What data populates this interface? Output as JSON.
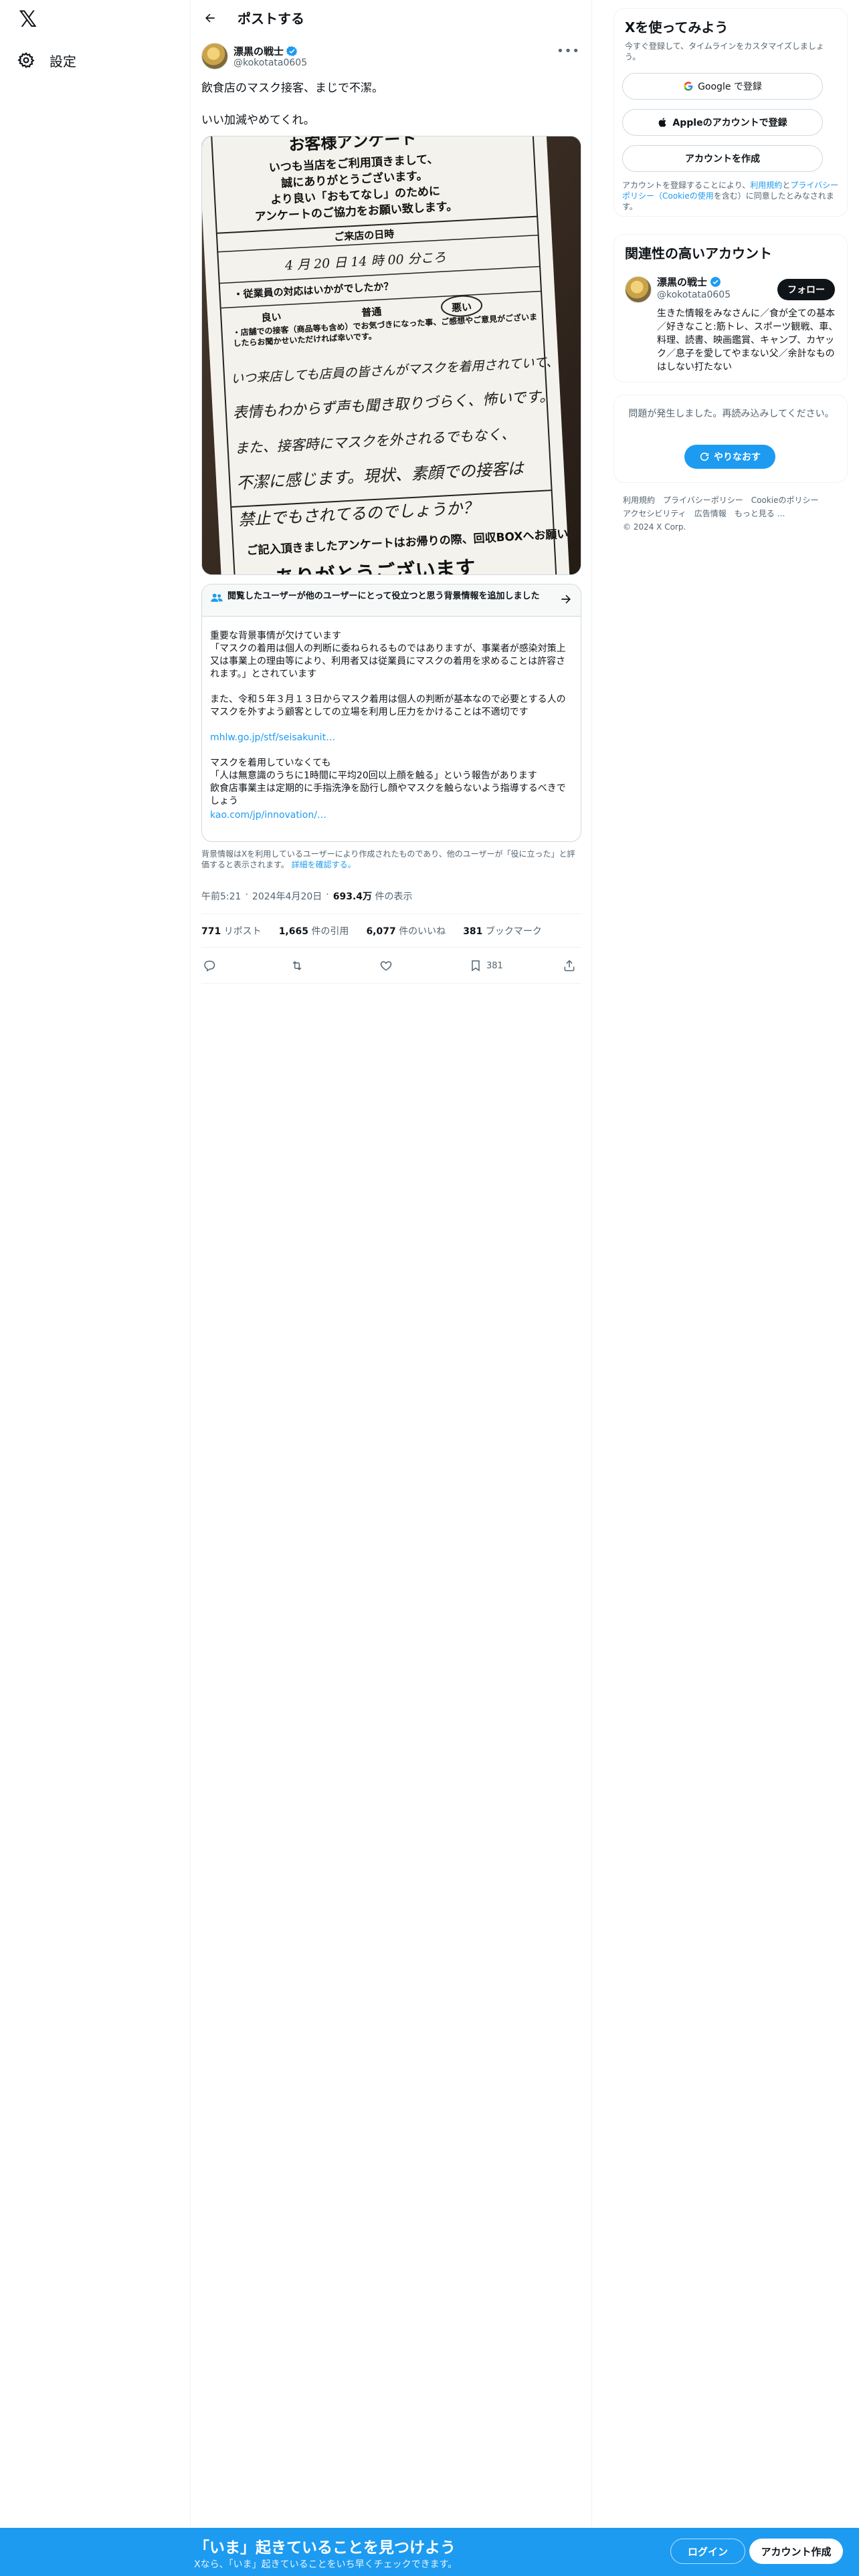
{
  "nav": {
    "logo": "𝕏",
    "settings_label": "設定"
  },
  "header": {
    "title": "ポストする"
  },
  "post": {
    "author_name": "漂黒の戦士",
    "author_handle": "@kokotata0605",
    "text": "飲食店のマスク接客、まじで不潔。\n\nいい加減やめてくれ。",
    "image": {
      "printed_title": "お客様アンケート",
      "printed_intro": [
        "いつも当店をご利用頂きまして、",
        "誠にありがとうございます。",
        "より良い「おもてなし」のために",
        "アンケートのご協力をお願い致します。"
      ],
      "visit_label": "ご来店の日時",
      "visit_value": "4 月 20 日 14 時 00 分ころ",
      "staff_question": "・従業員の対応はいかがでしたか？",
      "options": [
        "良い",
        "普通",
        "悪い"
      ],
      "comment_prompt": "・店舗での接客（商品等も含め）でお気づきになった事、ご感想やご意見がございましたらお聞かせいただければ幸いです。",
      "handwriting": [
        "いつ来店しても店員の皆さんがマスクを着用されていて、",
        "表情もわからず声も聞き取りづらく、怖いです。",
        "また、接客時にマスクを外されるでもなく、",
        "不潔に感じます。現状、素顔での接客は",
        "禁止でもされてるのでしょうか？"
      ],
      "printed_footer": "ご記入頂きましたアンケートはお帰りの際、回収BOXへお願い",
      "printed_thanks": "ありがとうございます"
    },
    "note": {
      "header": "閲覧したユーザーが他のユーザーにとって役立つと思う背景情報を追加しました",
      "paragraphs": [
        "重要な背景事情が欠けています\n「マスクの着用は個人の判断に委ねられるものではありますが、事業者が感染対策上又は事業上の理由等により、利用者又は従業員にマスクの着用を求めることは許容されます。」とされています",
        "また、令和５年３月１３日からマスク着用は個人の判断が基本なので必要とする人のマスクを外すよう顧客としての立場を利用し圧力をかけることは不適切です",
        "マスクを着用していなくても\n「人は無意識のうちに1時間に平均20回以上顔を触る」という報告があります\n飲食店事業主は定期的に手指洗浄を励行し顔やマスクを触らないよう指導するべきでしょう"
      ],
      "link1": "mhlw.go.jp/stf/seisakunit…",
      "link2": "kao.com/jp/innovation/…",
      "footer_text": "背景情報はXを利用しているユーザーにより作成されたものであり、他のユーザーが「役に立った」と評価すると表示されます。",
      "footer_link": "詳細を確認する。"
    },
    "time": "午前5:21",
    "date": "2024年4月20日",
    "views_count": "693.4万",
    "views_label": "件の表示",
    "stats": {
      "reposts_count": "771",
      "reposts_label": "リポスト",
      "quotes_count": "1,665",
      "quotes_label": "件の引用",
      "likes_count": "6,077",
      "likes_label": "件のいいね",
      "bookmarks_count": "381",
      "bookmarks_label": "ブックマーク"
    },
    "actions": {
      "bookmark_count": "381"
    }
  },
  "sidebar": {
    "signup": {
      "title": "Xを使ってみよう",
      "subtitle": "今すぐ登録して、タイムラインをカスタマイズしましょう。",
      "google_label": "Google で登録",
      "apple_label": "Appleのアカウントで登録",
      "create_label": "アカウントを作成",
      "terms_prefix": "アカウントを登録することにより、",
      "terms_link1": "利用規約",
      "terms_and": "と",
      "terms_link2": "プライバシーポリシー",
      "terms_link3": "（Cookieの使用",
      "terms_suffix": "を含む）に同意したとみなされます。"
    },
    "related": {
      "title": "関連性の高いアカウント",
      "name": "漂黒の戦士",
      "handle": "@kokotata0605",
      "follow_label": "フォロー",
      "bio": "生きた情報をみなさんに／食が全ての基本／好きなこと:筋トレ、スポーツ観戦、車、料理、読書、映画鑑賞、キャンプ、カヤック／息子を愛してやまない父／余計なものはしない打たない"
    },
    "error": {
      "message": "問題が発生しました。再読み込みしてください。",
      "retry_label": "やりなおす"
    },
    "footer_links": [
      "利用規約",
      "プライバシーポリシー",
      "Cookieのポリシー",
      "アクセシビリティ",
      "広告情報",
      "もっと見る …",
      "© 2024 X Corp."
    ]
  },
  "bottom_bar": {
    "title": "「いま」起きていることを見つけよう",
    "subtitle": "Xなら、「いま」起きていることをいち早くチェックできます。",
    "login_label": "ログイン",
    "signup_label": "アカウント作成"
  },
  "colors": {
    "accent": "#1d9bf0",
    "text": "#0f1419",
    "muted": "#536471",
    "border": "#eff3f4"
  }
}
